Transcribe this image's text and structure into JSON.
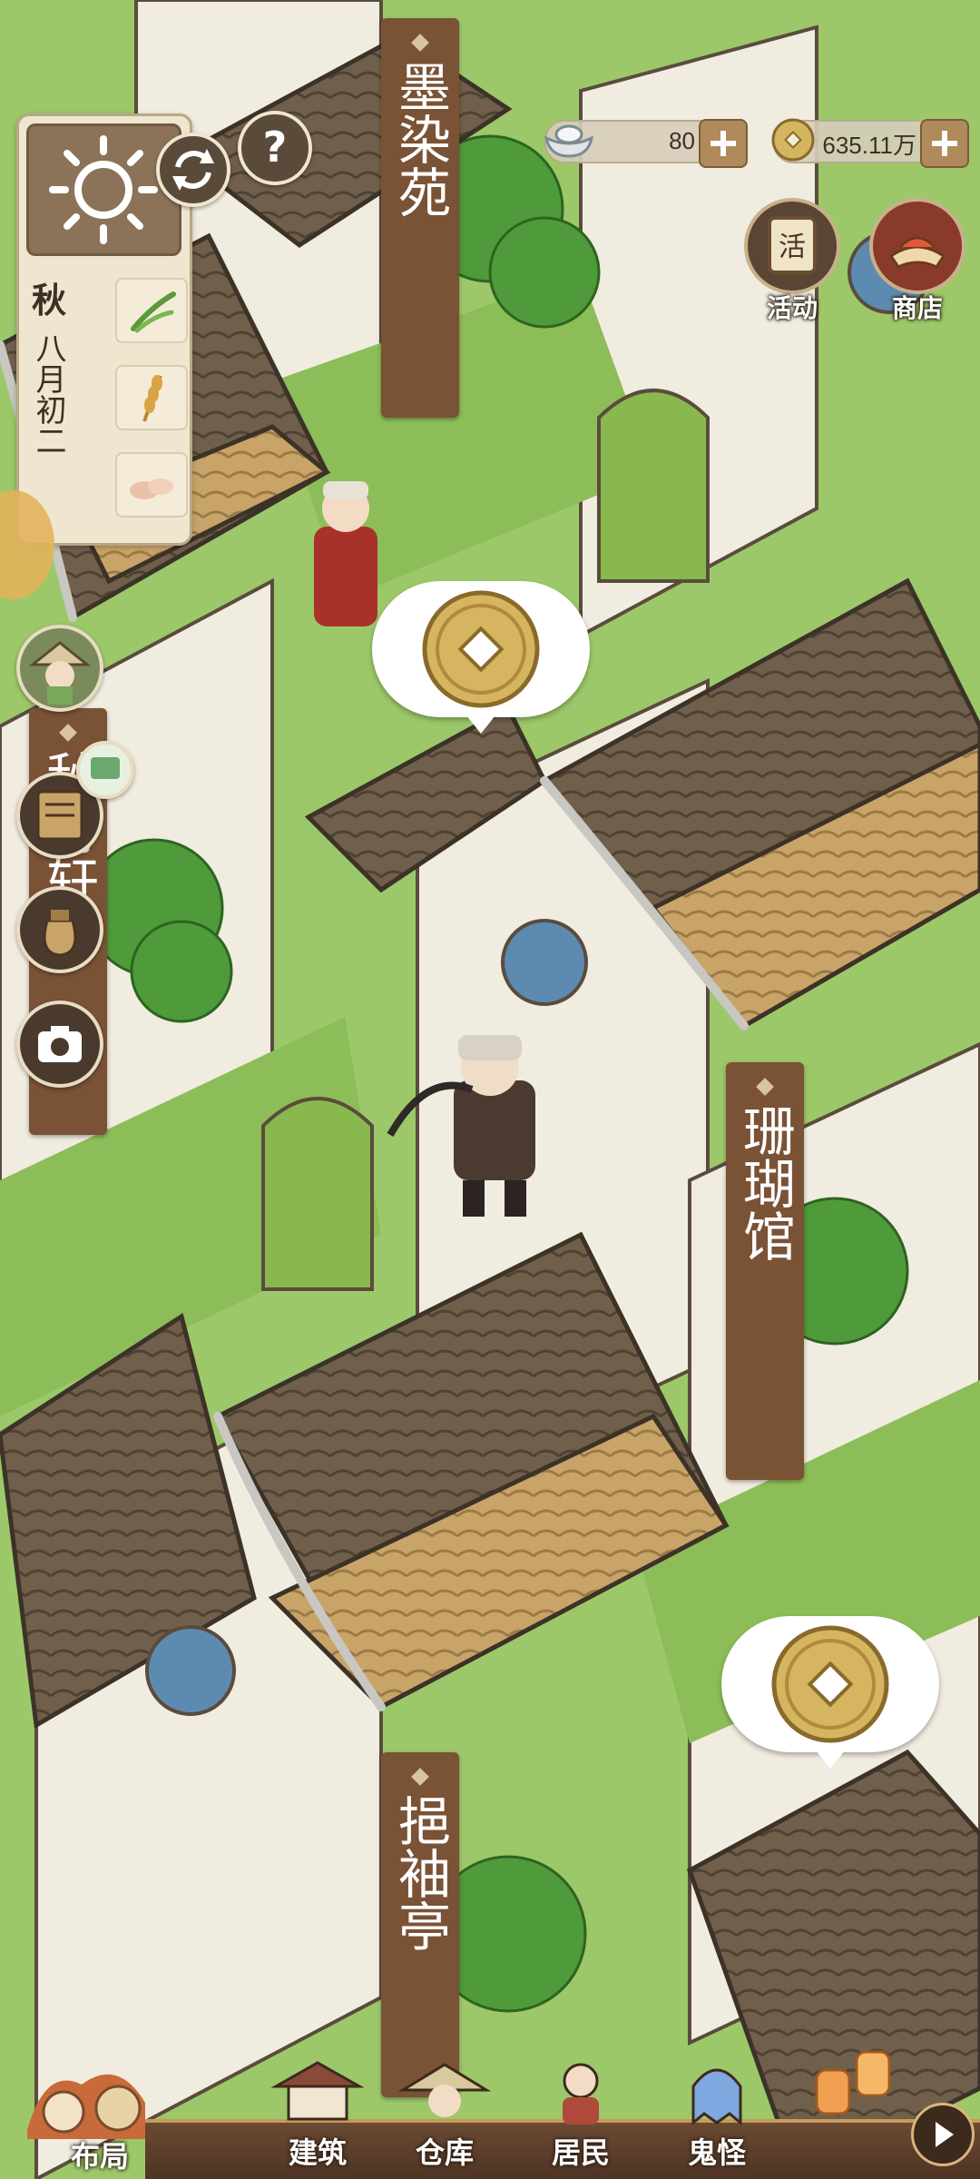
{
  "hud": {
    "season": "秋",
    "date": "八月初二",
    "crops": [
      "scallion-icon",
      "wheat-icon",
      "tofu-icon"
    ]
  },
  "currency": {
    "silver_value": "80",
    "coin_value": "635.11万"
  },
  "top_buttons": {
    "activity_label": "活动",
    "activity_badge": "活",
    "shop_label": "商店"
  },
  "banners": {
    "b1": "墨染苑",
    "b2": "珊瑚馆",
    "b3": "挹袖亭",
    "b4": "秋月轩"
  },
  "nav": {
    "layout": "布局",
    "build": "建筑",
    "storage": "仓库",
    "residents": "居民",
    "ghosts": "鬼怪"
  },
  "colors": {
    "banner": "#7a5236",
    "roof": "#7a6a52",
    "wall": "#f1ece0",
    "grass": "#9cc86a",
    "coin": "#d6b560"
  }
}
